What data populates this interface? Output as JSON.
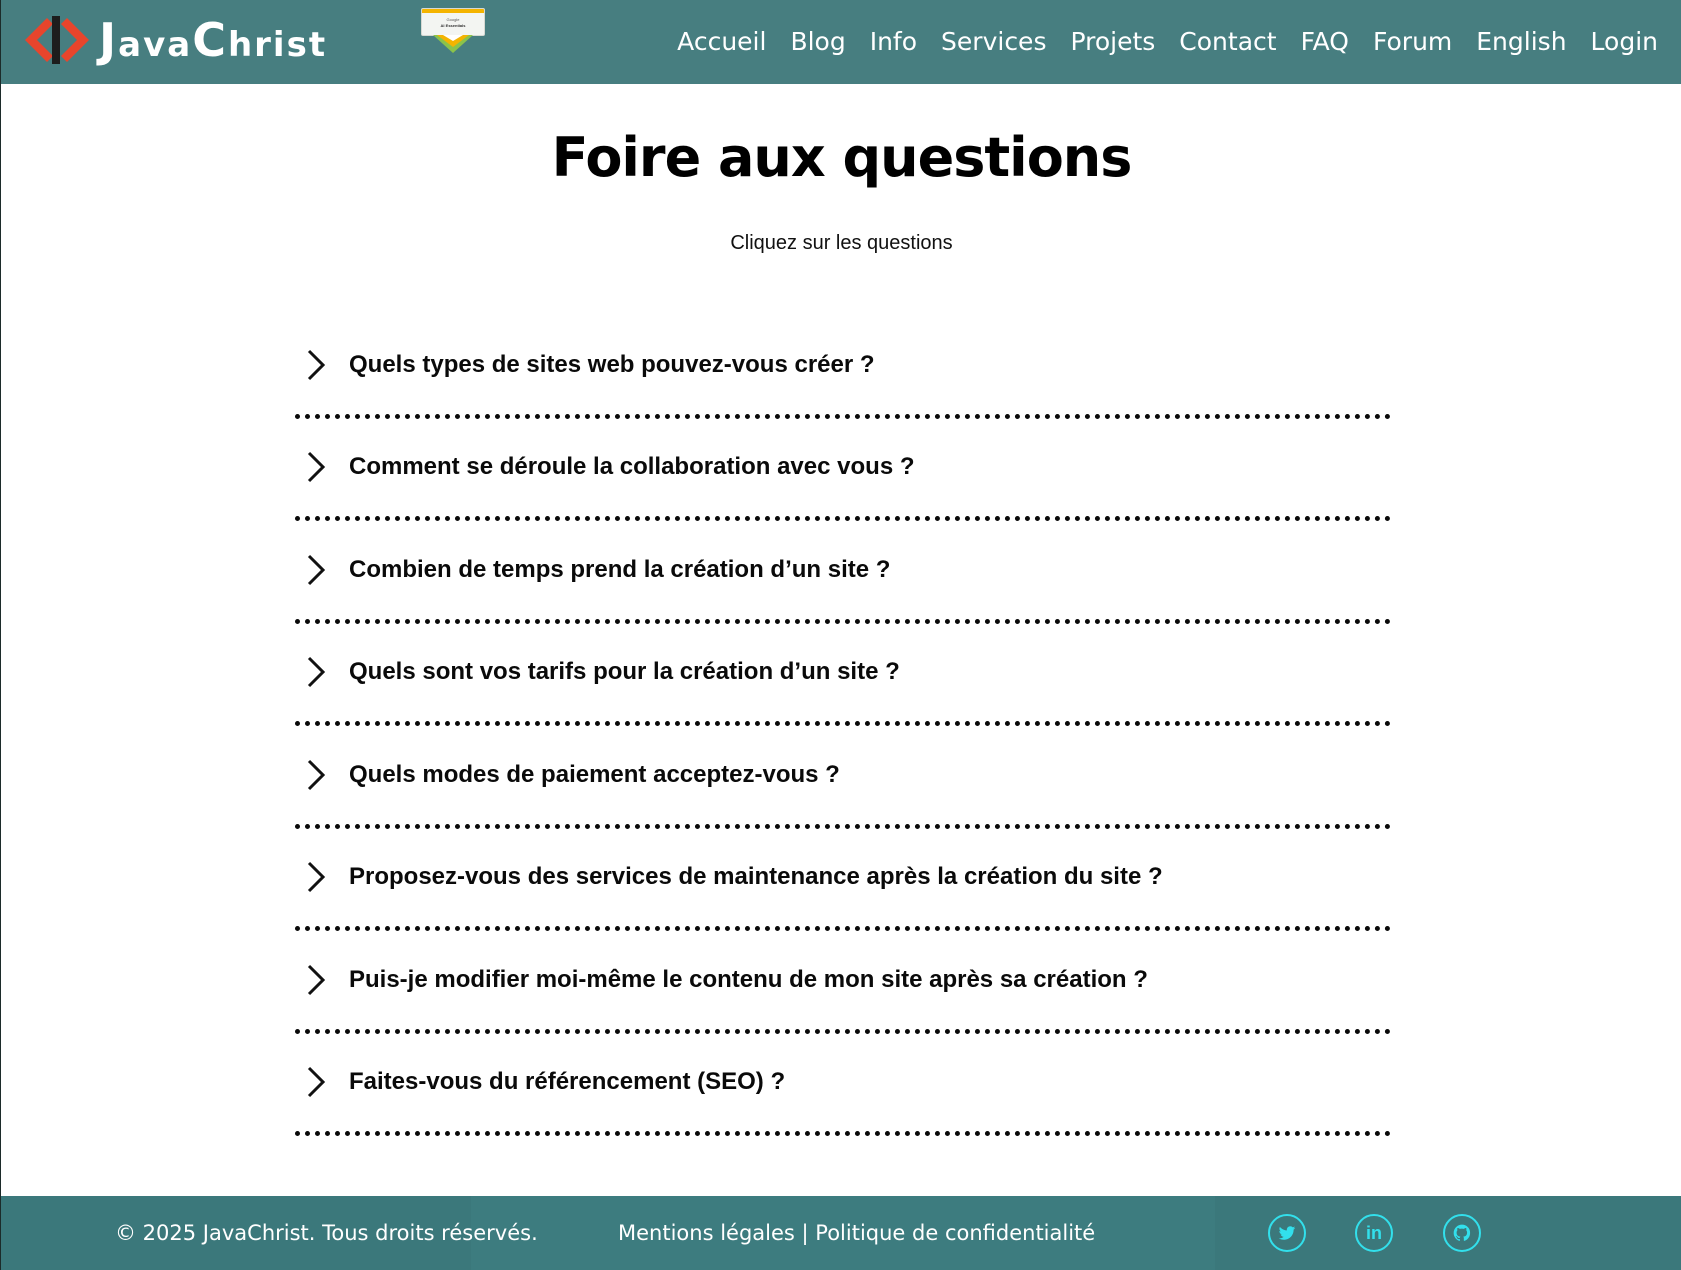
{
  "header": {
    "brand_name": "JavaChrist",
    "brand_first_letter": "J",
    "brand_middle": "ava",
    "brand_second_letter": "C",
    "brand_end": "hrist",
    "badge_line1": "Google",
    "badge_line2": "AI Essentials",
    "nav": [
      {
        "label": "Accueil"
      },
      {
        "label": "Blog"
      },
      {
        "label": "Info"
      },
      {
        "label": "Services"
      },
      {
        "label": "Projets"
      },
      {
        "label": "Contact"
      },
      {
        "label": "FAQ"
      },
      {
        "label": "Forum"
      },
      {
        "label": "English"
      },
      {
        "label": "Login"
      }
    ]
  },
  "main": {
    "title": "Foire aux questions",
    "subtitle": "Cliquez sur les questions",
    "faq": [
      {
        "question": "Quels types de sites web pouvez-vous créer ?"
      },
      {
        "question": "Comment se déroule la collaboration avec vous ?"
      },
      {
        "question": "Combien de temps prend la création d’un site ?"
      },
      {
        "question": "Quels sont vos tarifs pour la création d’un site ?"
      },
      {
        "question": "Quels modes de paiement acceptez-vous ?"
      },
      {
        "question": "Proposez-vous des services de maintenance après la création du site ?"
      },
      {
        "question": "Puis-je modifier moi-même le contenu de mon site après sa création ?"
      },
      {
        "question": "Faites-vous du référencement (SEO) ?"
      }
    ]
  },
  "footer": {
    "copyright": "© 2025 JavaChrist. Tous droits réservés.",
    "legal_link": "Mentions légales",
    "separator": "|",
    "privacy_link": "Politique de confidentialité",
    "social": [
      {
        "icon": "twitter-icon"
      },
      {
        "icon": "linkedin-icon"
      },
      {
        "icon": "github-icon"
      }
    ]
  },
  "colors": {
    "header_bg": "#477e80",
    "footer_bg": "#3b787b",
    "social_accent": "#32e0ec",
    "logo_orange": "#e8452c"
  }
}
